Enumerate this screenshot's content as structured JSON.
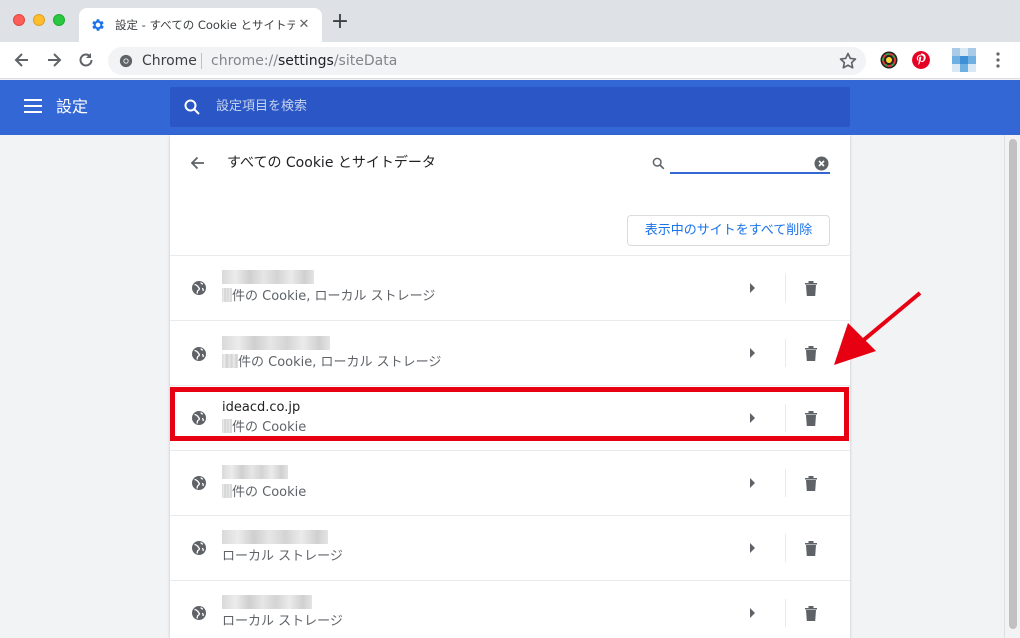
{
  "browser": {
    "tab_title": "設定 - すべての Cookie とサイトデ",
    "omnibox": {
      "chip_label": "Chrome",
      "url_scheme": "chrome://",
      "url_host": "settings",
      "url_path": "/siteData"
    }
  },
  "settings": {
    "header_title": "設定",
    "search_placeholder": "設定項目を検索"
  },
  "subpage": {
    "title": "すべての Cookie とサイトデータ",
    "filter_value": "",
    "remove_all_label": "表示中のサイトをすべて削除"
  },
  "sites": [
    {
      "name": "",
      "description": "件の Cookie, ローカル ストレージ"
    },
    {
      "name": "",
      "description": "件の Cookie, ローカル ストレージ"
    },
    {
      "name": "ideacd.co.jp",
      "description": "件の Cookie"
    },
    {
      "name": "",
      "description": "件の Cookie"
    },
    {
      "name": "",
      "description": "ローカル ストレージ"
    },
    {
      "name": "",
      "description": "ローカル ストレージ"
    }
  ],
  "colors": {
    "header_blue": "#3367d6",
    "accent": "#1a73e8",
    "highlight_red": "#e60012"
  },
  "icons": [
    "settings-icon",
    "close-icon",
    "plus-icon",
    "back-icon",
    "forward-icon",
    "reload-icon",
    "chrome-icon",
    "star-icon",
    "menu-icon",
    "search-icon",
    "globe-icon",
    "arrow-right-icon",
    "trash-icon"
  ]
}
